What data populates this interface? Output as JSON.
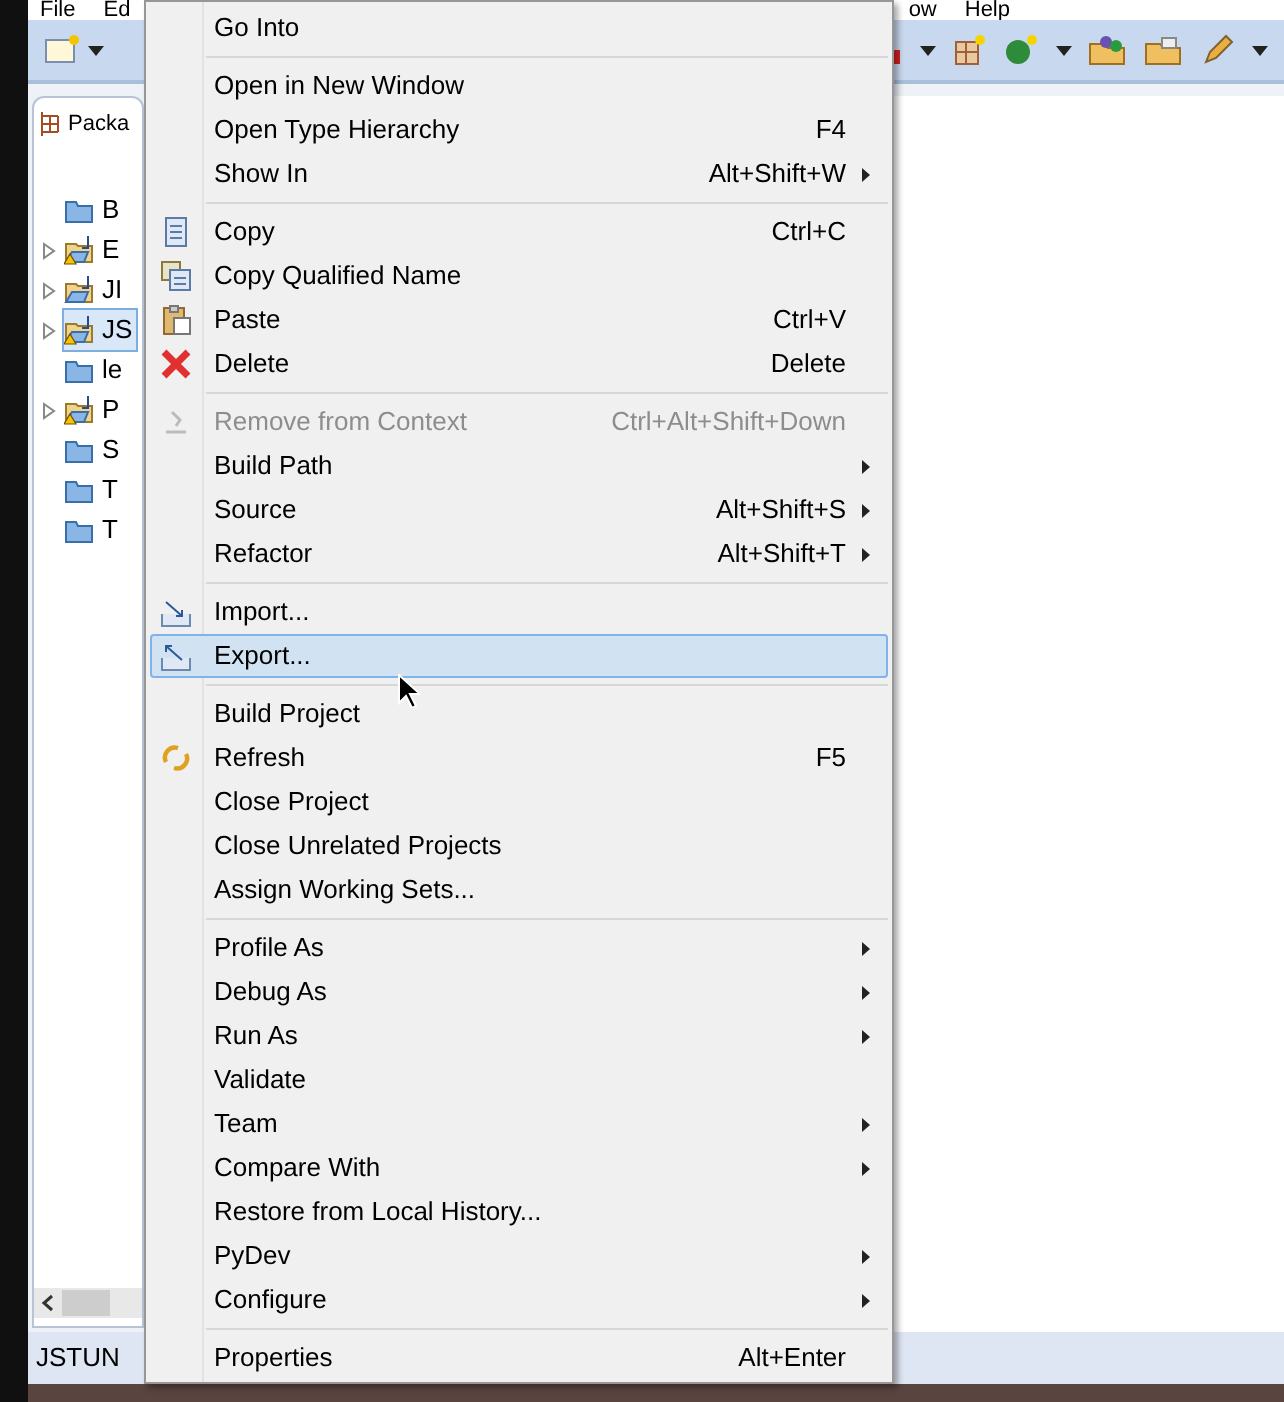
{
  "menu_bar": [
    "File",
    "Ed",
    "ow",
    "Help"
  ],
  "explorer": {
    "tab": "Packa",
    "items": [
      {
        "label": "B",
        "kind": "folder",
        "warning": false,
        "selected": false
      },
      {
        "label": "E",
        "kind": "project",
        "warning": true,
        "selected": false
      },
      {
        "label": "JI",
        "kind": "project",
        "warning": false,
        "selected": false
      },
      {
        "label": "JS",
        "kind": "project",
        "warning": true,
        "selected": true
      },
      {
        "label": "le",
        "kind": "folder",
        "warning": false,
        "selected": false
      },
      {
        "label": "P",
        "kind": "project",
        "warning": true,
        "selected": false
      },
      {
        "label": "S",
        "kind": "folder",
        "warning": false,
        "selected": false
      },
      {
        "label": "T",
        "kind": "folder",
        "warning": false,
        "selected": false
      },
      {
        "label": "T",
        "kind": "folder",
        "warning": false,
        "selected": false
      }
    ]
  },
  "status_bar": "JSTUN",
  "context_menu": [
    {
      "kind": "item",
      "label": "Go Into",
      "disabled": false,
      "selected": false,
      "submenu": false
    },
    {
      "kind": "separator"
    },
    {
      "kind": "item",
      "label": "Open in New Window",
      "disabled": false,
      "selected": false,
      "submenu": false
    },
    {
      "kind": "item",
      "label": "Open Type Hierarchy",
      "shortcut": "F4",
      "disabled": false,
      "selected": false,
      "submenu": false
    },
    {
      "kind": "item",
      "label": "Show In",
      "shortcut": "Alt+Shift+W",
      "disabled": false,
      "selected": false,
      "submenu": true
    },
    {
      "kind": "separator"
    },
    {
      "kind": "item",
      "label": "Copy",
      "shortcut": "Ctrl+C",
      "disabled": false,
      "selected": false,
      "submenu": false
    },
    {
      "kind": "item",
      "label": "Copy Qualified Name",
      "disabled": false,
      "selected": false,
      "submenu": false
    },
    {
      "kind": "item",
      "label": "Paste",
      "shortcut": "Ctrl+V",
      "disabled": false,
      "selected": false,
      "submenu": false
    },
    {
      "kind": "item",
      "label": "Delete",
      "shortcut": "Delete",
      "disabled": false,
      "selected": false,
      "submenu": false
    },
    {
      "kind": "separator"
    },
    {
      "kind": "item",
      "label": "Remove from Context",
      "shortcut": "Ctrl+Alt+Shift+Down",
      "disabled": true,
      "selected": false,
      "submenu": false
    },
    {
      "kind": "item",
      "label": "Build Path",
      "disabled": false,
      "selected": false,
      "submenu": true
    },
    {
      "kind": "item",
      "label": "Source",
      "shortcut": "Alt+Shift+S",
      "disabled": false,
      "selected": false,
      "submenu": true
    },
    {
      "kind": "item",
      "label": "Refactor",
      "shortcut": "Alt+Shift+T",
      "disabled": false,
      "selected": false,
      "submenu": true
    },
    {
      "kind": "separator"
    },
    {
      "kind": "item",
      "label": "Import...",
      "disabled": false,
      "selected": false,
      "submenu": false
    },
    {
      "kind": "item",
      "label": "Export...",
      "disabled": false,
      "selected": true,
      "submenu": false
    },
    {
      "kind": "separator"
    },
    {
      "kind": "item",
      "label": "Build Project",
      "disabled": false,
      "selected": false,
      "submenu": false
    },
    {
      "kind": "item",
      "label": "Refresh",
      "shortcut": "F5",
      "disabled": false,
      "selected": false,
      "submenu": false
    },
    {
      "kind": "item",
      "label": "Close Project",
      "disabled": false,
      "selected": false,
      "submenu": false
    },
    {
      "kind": "item",
      "label": "Close Unrelated Projects",
      "disabled": false,
      "selected": false,
      "submenu": false
    },
    {
      "kind": "item",
      "label": "Assign Working Sets...",
      "disabled": false,
      "selected": false,
      "submenu": false
    },
    {
      "kind": "separator"
    },
    {
      "kind": "item",
      "label": "Profile As",
      "disabled": false,
      "selected": false,
      "submenu": true
    },
    {
      "kind": "item",
      "label": "Debug As",
      "disabled": false,
      "selected": false,
      "submenu": true
    },
    {
      "kind": "item",
      "label": "Run As",
      "disabled": false,
      "selected": false,
      "submenu": true
    },
    {
      "kind": "item",
      "label": "Validate",
      "disabled": false,
      "selected": false,
      "submenu": false
    },
    {
      "kind": "item",
      "label": "Team",
      "disabled": false,
      "selected": false,
      "submenu": true
    },
    {
      "kind": "item",
      "label": "Compare With",
      "disabled": false,
      "selected": false,
      "submenu": true
    },
    {
      "kind": "item",
      "label": "Restore from Local History...",
      "disabled": false,
      "selected": false,
      "submenu": false
    },
    {
      "kind": "item",
      "label": "PyDev",
      "disabled": false,
      "selected": false,
      "submenu": true
    },
    {
      "kind": "item",
      "label": "Configure",
      "disabled": false,
      "selected": false,
      "submenu": true
    },
    {
      "kind": "separator"
    },
    {
      "kind": "item",
      "label": "Properties",
      "shortcut": "Alt+Enter",
      "disabled": false,
      "selected": false,
      "submenu": false
    }
  ]
}
